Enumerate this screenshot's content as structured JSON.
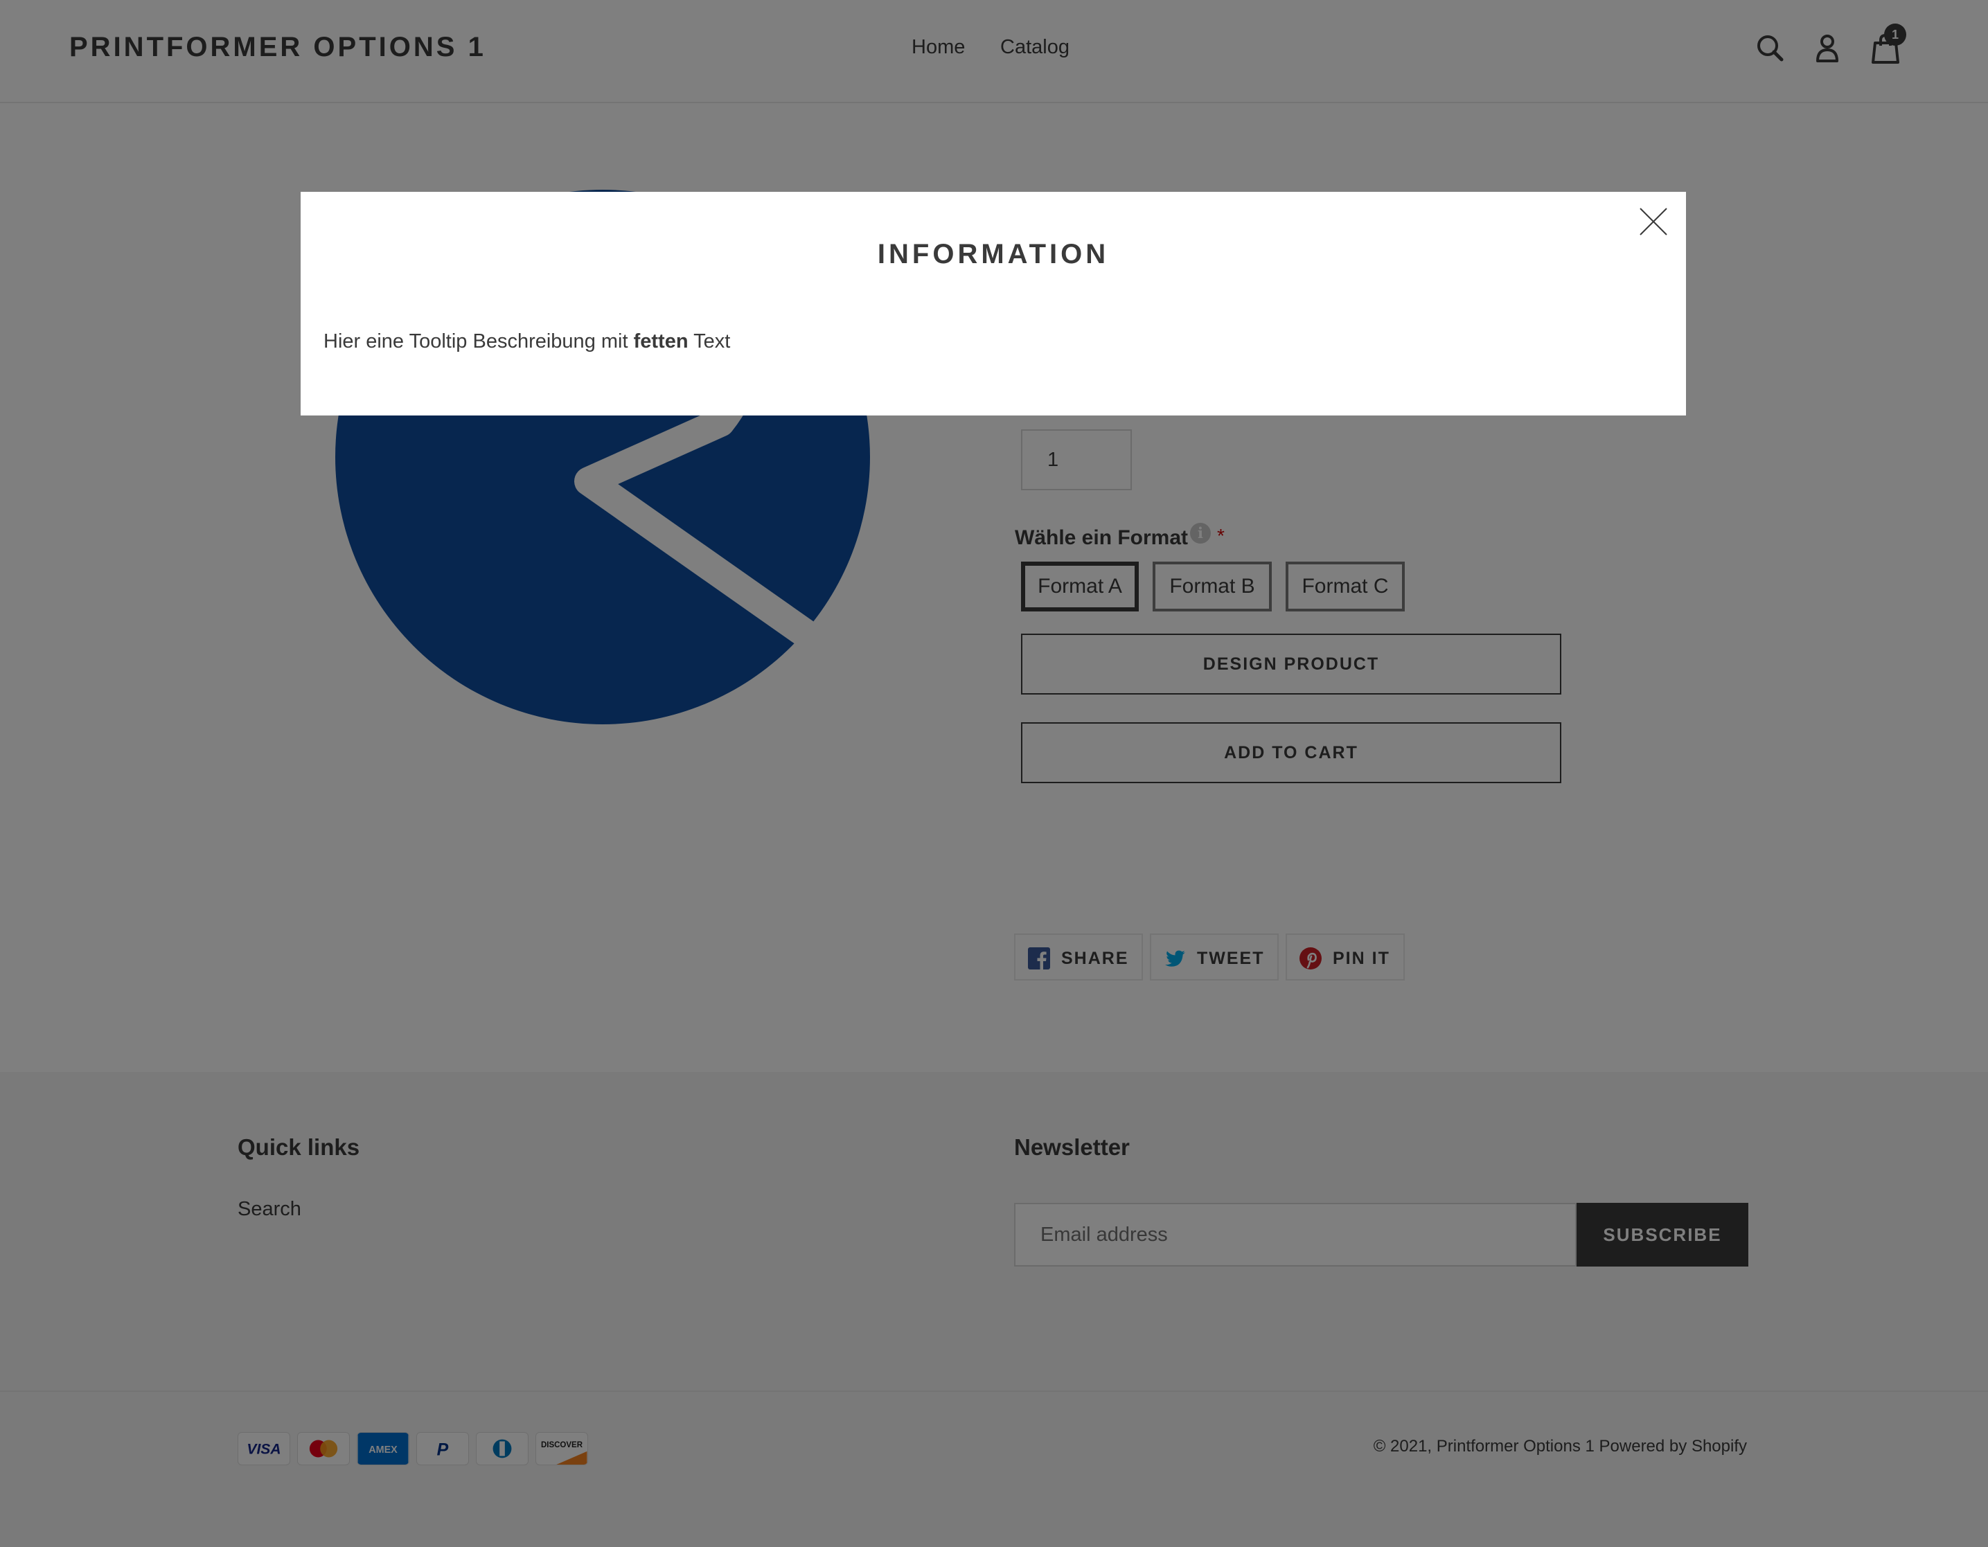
{
  "header": {
    "store_name": "PRINTFORMER OPTIONS 1",
    "nav": [
      "Home",
      "Catalog"
    ],
    "cart_count": "1"
  },
  "product": {
    "quantity_value": "1",
    "format_label": "Wähle ein Format",
    "info_icon": "i",
    "required_mark": "*",
    "formats": [
      "Format A",
      "Format B",
      "Format C"
    ],
    "selected_format": "Format A",
    "design_button": "DESIGN PRODUCT",
    "add_to_cart_button": "ADD TO CART",
    "share": [
      "SHARE",
      "TWEET",
      "PIN IT"
    ],
    "image_colors": {
      "circle": "#0f4d9e",
      "mark": "#ffffff"
    }
  },
  "modal": {
    "title": "INFORMATION",
    "body_before": "Hier eine Tooltip Beschreibung mit ",
    "body_bold": "fetten",
    "body_after": " Text"
  },
  "footer": {
    "quick_links_heading": "Quick links",
    "quick_links": [
      "Search"
    ],
    "newsletter_heading": "Newsletter",
    "email_placeholder": "Email address",
    "subscribe_button": "SUBSCRIBE",
    "payment_icons": [
      "visa-icon",
      "mastercard-icon",
      "amex-icon",
      "paypal-icon",
      "diners-club-icon",
      "discover-icon"
    ],
    "copyright": "© 2021, Printformer Options 1",
    "powered_by": "Powered by Shopify"
  },
  "colors": {
    "text": "#3a3a3a",
    "footer_bg": "#f5f5f5",
    "overlay": "rgba(0,0,0,0.5)",
    "required": "#cc0000"
  }
}
